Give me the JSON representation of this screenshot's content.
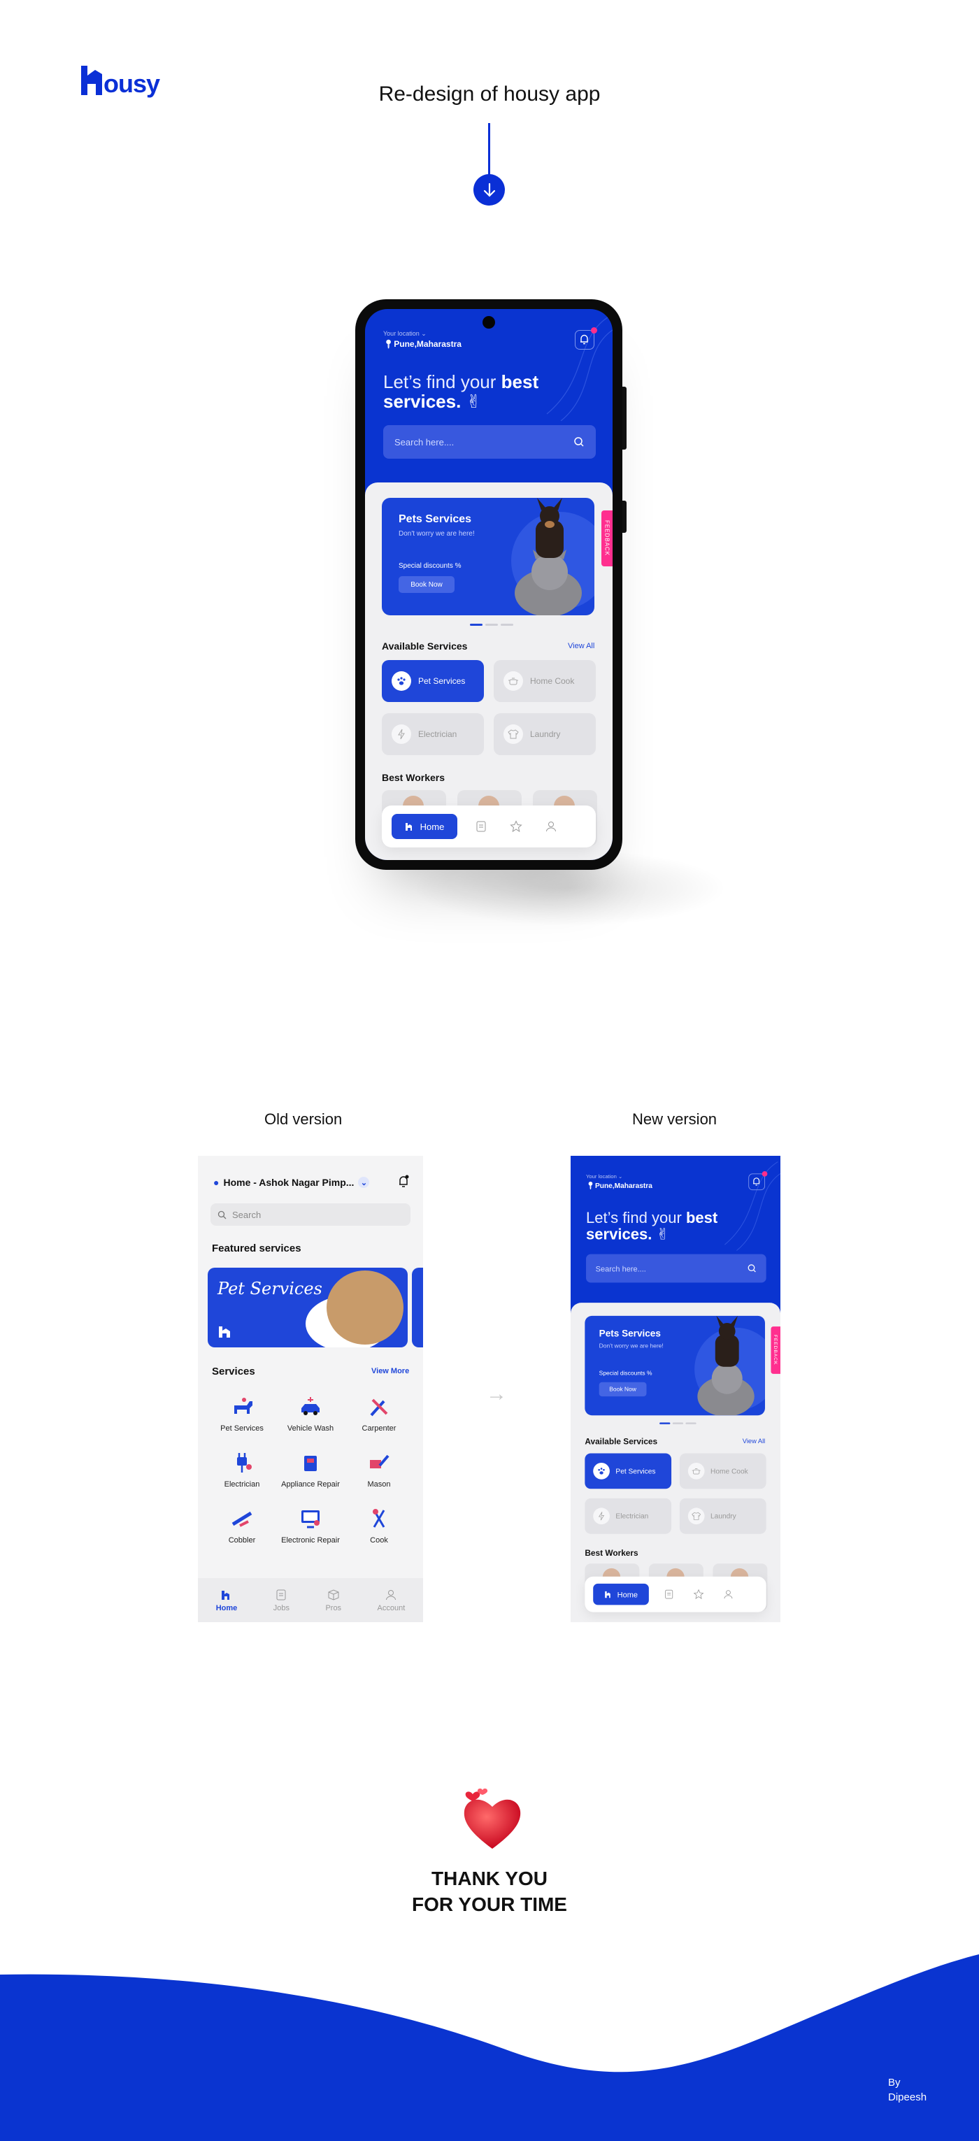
{
  "header": {
    "logo_text": "ousy",
    "title": "Re-design of housy app"
  },
  "app": {
    "location_label": "Your location",
    "location_value": "Pune,Maharastra",
    "headline_light": "Let’s find your",
    "headline_bold_1": "best",
    "headline_bold_2": "services.",
    "search_placeholder": "Search here....",
    "banner": {
      "title": "Pets Services",
      "subtitle": "Don't worry we are here!",
      "discount": "Special discounts %",
      "cta": "Book Now"
    },
    "feedback_label": "FEEDBACK",
    "available_title": "Available Services",
    "view_all": "View All",
    "services": [
      {
        "label": "Pet Services",
        "icon": "paw-icon",
        "active": true
      },
      {
        "label": "Home Cook",
        "icon": "cooking-pot-icon",
        "active": false
      },
      {
        "label": "Electrician",
        "icon": "lightning-icon",
        "active": false
      },
      {
        "label": "Laundry",
        "icon": "shirt-icon",
        "active": false
      }
    ],
    "best_workers_title": "Best Workers",
    "nav": {
      "home": "Home"
    }
  },
  "comparison": {
    "old_label": "Old version",
    "new_label": "New version",
    "arrow": "→"
  },
  "old_app": {
    "location": "Home - Ashok Nagar Pimp...",
    "search_placeholder": "Search",
    "featured_title": "Featured services",
    "banner_text": "Pet Services",
    "services_title": "Services",
    "view_more": "View More",
    "services": [
      {
        "label": "Pet Services",
        "icon": "dog-icon"
      },
      {
        "label": "Vehicle Wash",
        "icon": "car-icon"
      },
      {
        "label": "Carpenter",
        "icon": "hammer-icon"
      },
      {
        "label": "Electrician",
        "icon": "plug-icon"
      },
      {
        "label": "Appliance Repair",
        "icon": "appliance-icon"
      },
      {
        "label": "Mason",
        "icon": "trowel-icon"
      },
      {
        "label": "Cobbler",
        "icon": "shoe-icon"
      },
      {
        "label": "Electronic Repair",
        "icon": "monitor-icon"
      },
      {
        "label": "Cook",
        "icon": "utensils-icon"
      }
    ],
    "tabs": [
      {
        "label": "Home",
        "icon": "home-icon",
        "active": true
      },
      {
        "label": "Jobs",
        "icon": "document-icon",
        "active": false
      },
      {
        "label": "Pros",
        "icon": "box-icon",
        "active": false
      },
      {
        "label": "Account",
        "icon": "user-icon",
        "active": false
      }
    ]
  },
  "footer": {
    "thanks_line1": "THANK YOU",
    "thanks_line2": "FOR YOUR TIME",
    "by": "By",
    "author": "Dipeesh"
  },
  "colors": {
    "brand_blue": "#0a34d0",
    "accent_pink": "#ff2e8b"
  }
}
